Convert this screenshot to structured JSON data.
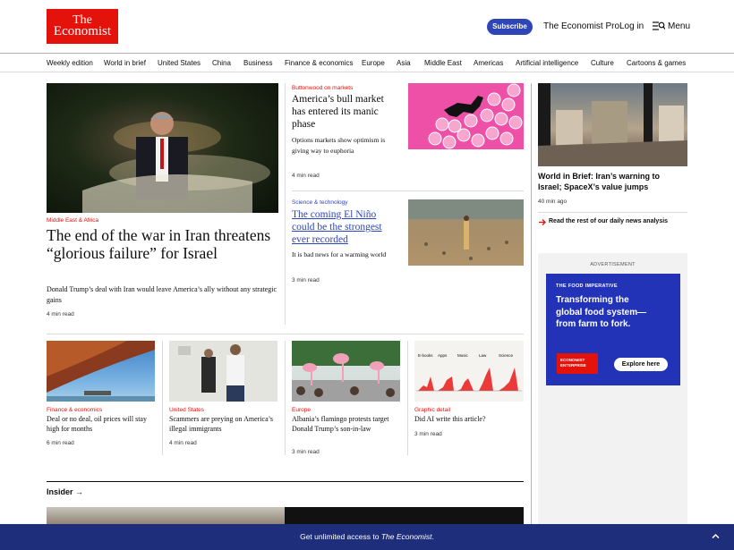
{
  "header": {
    "logo_line1": "The",
    "logo_line2": "Economist",
    "subscribe": "Subscribe",
    "pro": "The Economist Pro",
    "login": "Log in",
    "menu": "Menu"
  },
  "nav": [
    "Weekly edition",
    "World in brief",
    "United States",
    "China",
    "Business",
    "Finance & economics",
    "Europe",
    "Asia",
    "Middle East",
    "Americas",
    "Artificial intelligence",
    "Culture",
    "Cartoons & games"
  ],
  "lead": {
    "rubric": "Middle East & Africa",
    "title": "The end of the war in Iran threatens “glorious failure” for Israel",
    "summary": "Donald Trump’s deal with Iran would leave America’s ally without any strategic gains",
    "read": "4 min read"
  },
  "mid1": {
    "rubric": "Buttonwood on markets",
    "title": "America’s bull market has entered its manic phase",
    "summary": "Options markets show optimism is giving way to euphoria",
    "read": "4 min read"
  },
  "mid2": {
    "rubric": "Science & technology",
    "title": "The coming El Niño could be the strongest ever recorded",
    "summary": "It is bad news for a warming world",
    "read": "3 min read"
  },
  "brief": {
    "title": "World in Brief: Iran’s warning to Israel; SpaceX’s value jumps",
    "read": "40 min ago",
    "link": "Read the rest of our daily news analysis"
  },
  "ad": {
    "label": "ADVERTISEMENT",
    "kicker": "THE FOOD IMPERATIVE",
    "headline": "Transforming the global food system— from farm to fork.",
    "badge_line1": "ECONOMIST",
    "badge_line2": "ENTERPRISE",
    "cta": "Explore here"
  },
  "row": [
    {
      "rubric": "Finance & economics",
      "title": "Deal or no deal, oil prices will stay high for months",
      "read": "6 min read"
    },
    {
      "rubric": "United States",
      "title": "Scammers are preying on America’s illegal immigrants",
      "read": "4 min read"
    },
    {
      "rubric": "Europe",
      "title": "Albania’s flamingo protests target Donald Trump’s son-in-law",
      "read": "3 min read"
    },
    {
      "rubric": "Graphic detail",
      "title": "Did AI write this article?",
      "read": "3 min read"
    }
  ],
  "chart_labels": [
    "E-books",
    "Apps",
    "Music",
    "Law",
    "Science"
  ],
  "insider": "Insider",
  "bottom": {
    "prefix": "Get unlimited access to ",
    "brand": "The Economist",
    "suffix": "."
  },
  "colors": {
    "brand_red": "#e3120b",
    "subscribe_blue": "#2e45b8",
    "bar_navy": "#1f2e7a"
  }
}
